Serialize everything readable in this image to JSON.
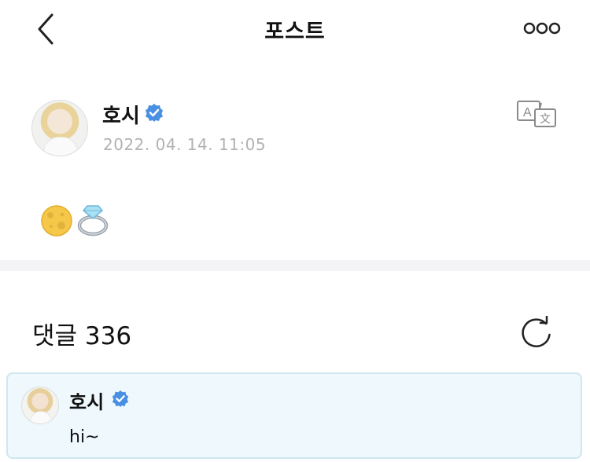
{
  "header": {
    "title": "포스트"
  },
  "post": {
    "author": "호시",
    "date": "2022. 04. 14. 11:05",
    "content_emojis": [
      "full-moon",
      "ring"
    ]
  },
  "comments": {
    "label": "댓글 336",
    "items": [
      {
        "author": "호시",
        "text": "hi~"
      }
    ]
  },
  "icons": {
    "back": "chevron-left-icon",
    "more": "more-horizontal-icon",
    "translate": "translate-icon",
    "refresh": "refresh-icon",
    "verified": "verified-badge-icon"
  },
  "colors": {
    "verified": "#4a90e2",
    "date": "#b2b2b2",
    "divider": "#f4f4f6",
    "comment_bg": "#eef8fd",
    "comment_border": "#cfe7ef"
  }
}
